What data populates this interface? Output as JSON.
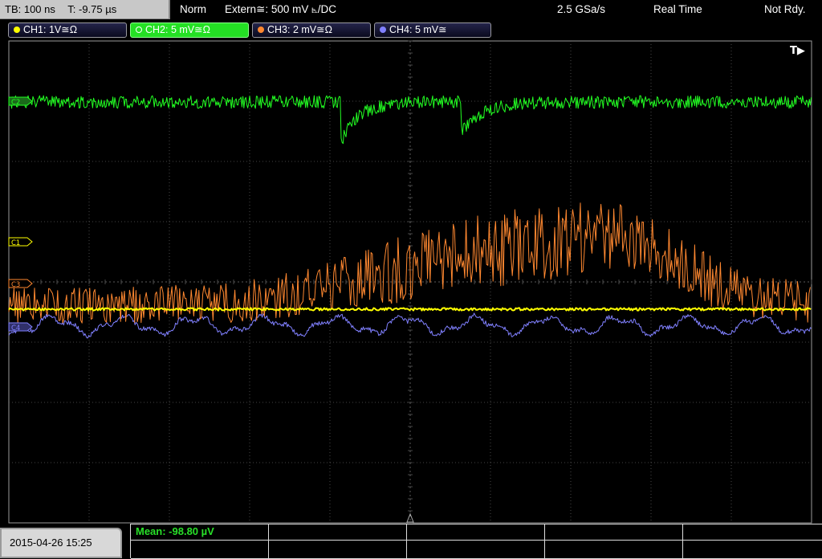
{
  "topbar": {
    "timebase": "TB: 100 ns",
    "trigger_time": "T: -9.75 µs",
    "acq_mode": "Norm",
    "trigger_source": "Extern≅: 500 mV ⦝/DC",
    "sample_rate": "2.5 GSa/s",
    "realtime": "Real Time",
    "status": "Not Rdy."
  },
  "channels": [
    {
      "label": "CH1: 1V≅Ω",
      "color": "#ffff00",
      "active": false
    },
    {
      "label": "CH2: 5 mV≅Ω",
      "color": "#22ff22",
      "active": true
    },
    {
      "label": "CH3: 2 mV≅Ω",
      "color": "#ff8830",
      "active": false
    },
    {
      "label": "CH4: 5 mV≅",
      "color": "#8080ff",
      "active": false
    }
  ],
  "markers": {
    "c1": "C1",
    "c2": "C2",
    "c3": "C3",
    "c4": "C4",
    "trigger": "T▶"
  },
  "datetime": "2015-04-26 15:25",
  "measurement": "Mean: -98.80 µV",
  "colors": {
    "ch1": "#ffff00",
    "ch2": "#22ff22",
    "ch3": "#ff8830",
    "ch4": "#8080ff",
    "grid": "#5a5a5a"
  }
}
